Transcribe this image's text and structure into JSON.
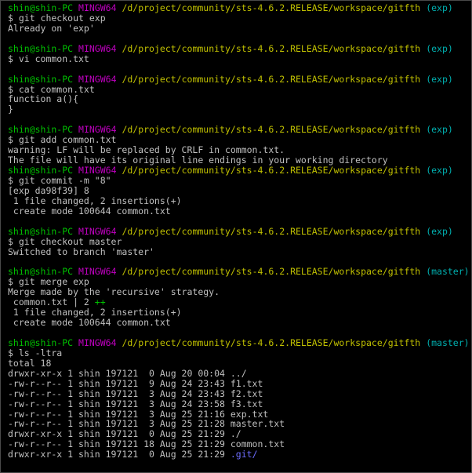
{
  "colors": {
    "background": "#000000",
    "text": "#c0c0c0",
    "user_host": "#00c000",
    "mingw": "#c000c0",
    "path": "#c0c000",
    "branch": "#00b0b0",
    "diff_plus": "#00c000",
    "directory": "#6e6eff"
  },
  "prompt": {
    "user_host": "shin@shin-PC",
    "system": "MINGW64",
    "path": "/d/project/community/sts-4.6.2.RELEASE/workspace/gitfth"
  },
  "lines": [
    {
      "kind": "prompt",
      "branch": "(exp)"
    },
    {
      "kind": "text",
      "text": "$ git checkout exp"
    },
    {
      "kind": "text",
      "text": "Already on 'exp'"
    },
    {
      "kind": "blank"
    },
    {
      "kind": "prompt",
      "branch": "(exp)"
    },
    {
      "kind": "text",
      "text": "$ vi common.txt"
    },
    {
      "kind": "blank"
    },
    {
      "kind": "prompt",
      "branch": "(exp)"
    },
    {
      "kind": "text",
      "text": "$ cat common.txt"
    },
    {
      "kind": "text",
      "text": "function a(){"
    },
    {
      "kind": "text",
      "text": "}"
    },
    {
      "kind": "blank"
    },
    {
      "kind": "prompt",
      "branch": "(exp)"
    },
    {
      "kind": "text",
      "text": "$ git add common.txt"
    },
    {
      "kind": "text",
      "text": "warning: LF will be replaced by CRLF in common.txt."
    },
    {
      "kind": "text",
      "text": "The file will have its original line endings in your working directory"
    },
    {
      "kind": "prompt",
      "branch": "(exp)"
    },
    {
      "kind": "text",
      "text": "$ git commit -m \"8\""
    },
    {
      "kind": "text",
      "text": "[exp da98f39] 8"
    },
    {
      "kind": "text",
      "text": " 1 file changed, 2 insertions(+)"
    },
    {
      "kind": "text",
      "text": " create mode 100644 common.txt"
    },
    {
      "kind": "blank"
    },
    {
      "kind": "prompt",
      "branch": "(exp)"
    },
    {
      "kind": "text",
      "text": "$ git checkout master"
    },
    {
      "kind": "text",
      "text": "Switched to branch 'master'"
    },
    {
      "kind": "blank"
    },
    {
      "kind": "prompt",
      "branch": "(master)"
    },
    {
      "kind": "text",
      "text": "$ git merge exp"
    },
    {
      "kind": "text",
      "text": "Merge made by the 'recursive' strategy."
    },
    {
      "kind": "diffstat",
      "text": " common.txt | 2 ",
      "plus": "++"
    },
    {
      "kind": "text",
      "text": " 1 file changed, 2 insertions(+)"
    },
    {
      "kind": "text",
      "text": " create mode 100644 common.txt"
    },
    {
      "kind": "blank"
    },
    {
      "kind": "prompt",
      "branch": "(master)"
    },
    {
      "kind": "text",
      "text": "$ ls -ltra"
    },
    {
      "kind": "text",
      "text": "total 18"
    },
    {
      "kind": "text",
      "text": "drwxr-xr-x 1 shin 197121  0 Aug 20 00:04 ../"
    },
    {
      "kind": "text",
      "text": "-rw-r--r-- 1 shin 197121  9 Aug 24 23:43 f1.txt"
    },
    {
      "kind": "text",
      "text": "-rw-r--r-- 1 shin 197121  3 Aug 24 23:43 f2.txt"
    },
    {
      "kind": "text",
      "text": "-rw-r--r-- 1 shin 197121  3 Aug 24 23:58 f3.txt"
    },
    {
      "kind": "text",
      "text": "-rw-r--r-- 1 shin 197121  3 Aug 25 21:16 exp.txt"
    },
    {
      "kind": "text",
      "text": "-rw-r--r-- 1 shin 197121  3 Aug 25 21:28 master.txt"
    },
    {
      "kind": "text",
      "text": "drwxr-xr-x 1 shin 197121  0 Aug 25 21:29 ./"
    },
    {
      "kind": "text",
      "text": "-rw-r--r-- 1 shin 197121 18 Aug 25 21:29 common.txt"
    },
    {
      "kind": "dirline",
      "text": "drwxr-xr-x 1 shin 197121  0 Aug 25 21:29 ",
      "dir": ".git/"
    }
  ]
}
